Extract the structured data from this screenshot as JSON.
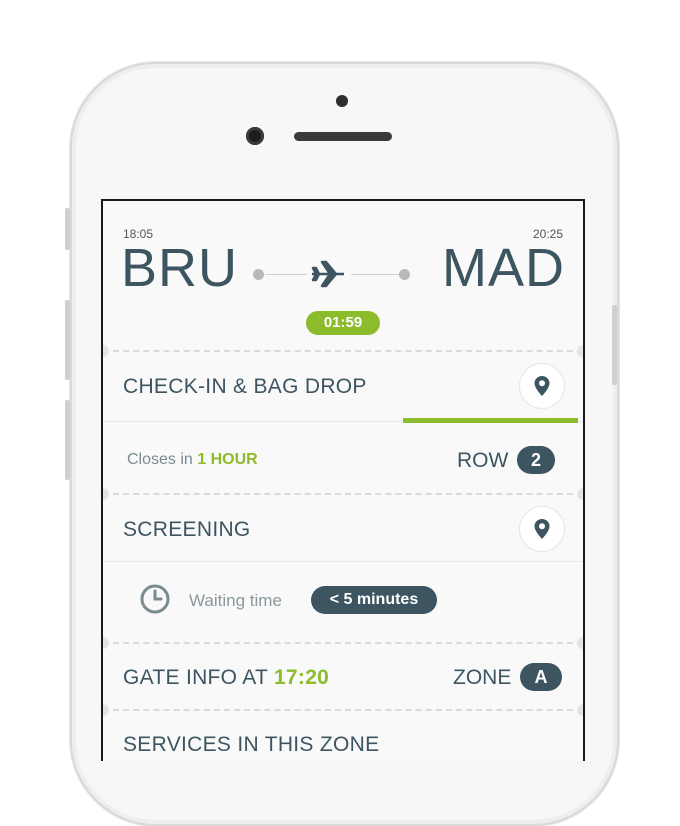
{
  "flight": {
    "departure_time": "18:05",
    "arrival_time": "20:25",
    "origin": "BRU",
    "destination": "MAD",
    "duration": "01:59",
    "plane_icon": "plane-icon"
  },
  "checkin": {
    "title": "CHECK-IN & BAG DROP",
    "pin_icon": "map-pin-icon",
    "closes_prefix": "Closes in",
    "closes_value": "1 HOUR",
    "row_label": "ROW",
    "row_value": "2"
  },
  "screening": {
    "title": "SCREENING",
    "pin_icon": "map-pin-icon",
    "waiting_label": "Waiting time",
    "waiting_value": "< 5 minutes"
  },
  "gate": {
    "title_prefix": "GATE INFO AT",
    "time": "17:20",
    "zone_label": "ZONE",
    "zone_value": "A"
  },
  "services": {
    "title": "SERVICES IN THIS ZONE"
  },
  "colors": {
    "accent_green": "#8cbb2b",
    "dark_slate": "#3d5561"
  }
}
